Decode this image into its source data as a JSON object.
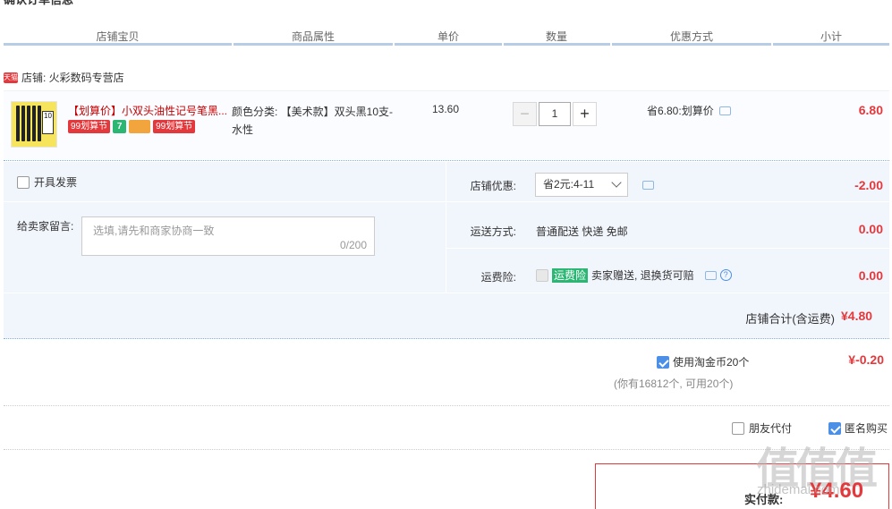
{
  "page": {
    "title": "确认订单信息"
  },
  "header": {
    "cols": [
      "店铺宝贝",
      "商品属性",
      "单价",
      "数量",
      "优惠方式",
      "小计"
    ]
  },
  "shop": {
    "badge": "天猫",
    "label": "店铺: 火彩数码专营店"
  },
  "item": {
    "title": "【划算价】小双头油性记号笔黑...",
    "tags": [
      "99划算节",
      "7",
      "",
      "99划算节"
    ],
    "attr": "颜色分类: 【美术款】双头黑10支-水性",
    "price": "13.60",
    "quantity": "1",
    "promo": "省6.80:划算价",
    "subtotal": "6.80",
    "thumb_text": "10"
  },
  "options": {
    "invoice_label": "开具发票",
    "message_label": "给卖家留言:",
    "message_placeholder": "选填,请先和商家协商一致",
    "message_count": "0/200",
    "shop_discount_label": "店铺优惠:",
    "shop_discount_value": "省2元:4-11",
    "shop_discount_amount": "-2.00",
    "shipping_label": "运送方式:",
    "shipping_value": "普通配送 快递 免邮",
    "shipping_amount": "0.00",
    "insurance_label": "运费险:",
    "insurance_badge": "运费险",
    "insurance_text": "卖家赠送, 退换货可赔",
    "insurance_amount": "0.00"
  },
  "shop_total": {
    "label": "店铺合计(含运费)",
    "value": "¥4.80"
  },
  "coins": {
    "label": "使用淘金币20个",
    "note": "(你有16812个, 可用20个)",
    "value": "¥-0.20"
  },
  "friend_pay_label": "朋友代付",
  "anonymous_label": "匿名购买",
  "payment": {
    "label": "实付款:",
    "value": "¥4.60"
  },
  "watermark": {
    "text": "值值值",
    "sub": "zhidemai.com"
  },
  "colors": {
    "accent": "#e4393c",
    "blue": "#4c8fe6",
    "panel": "#f1f5fc"
  }
}
